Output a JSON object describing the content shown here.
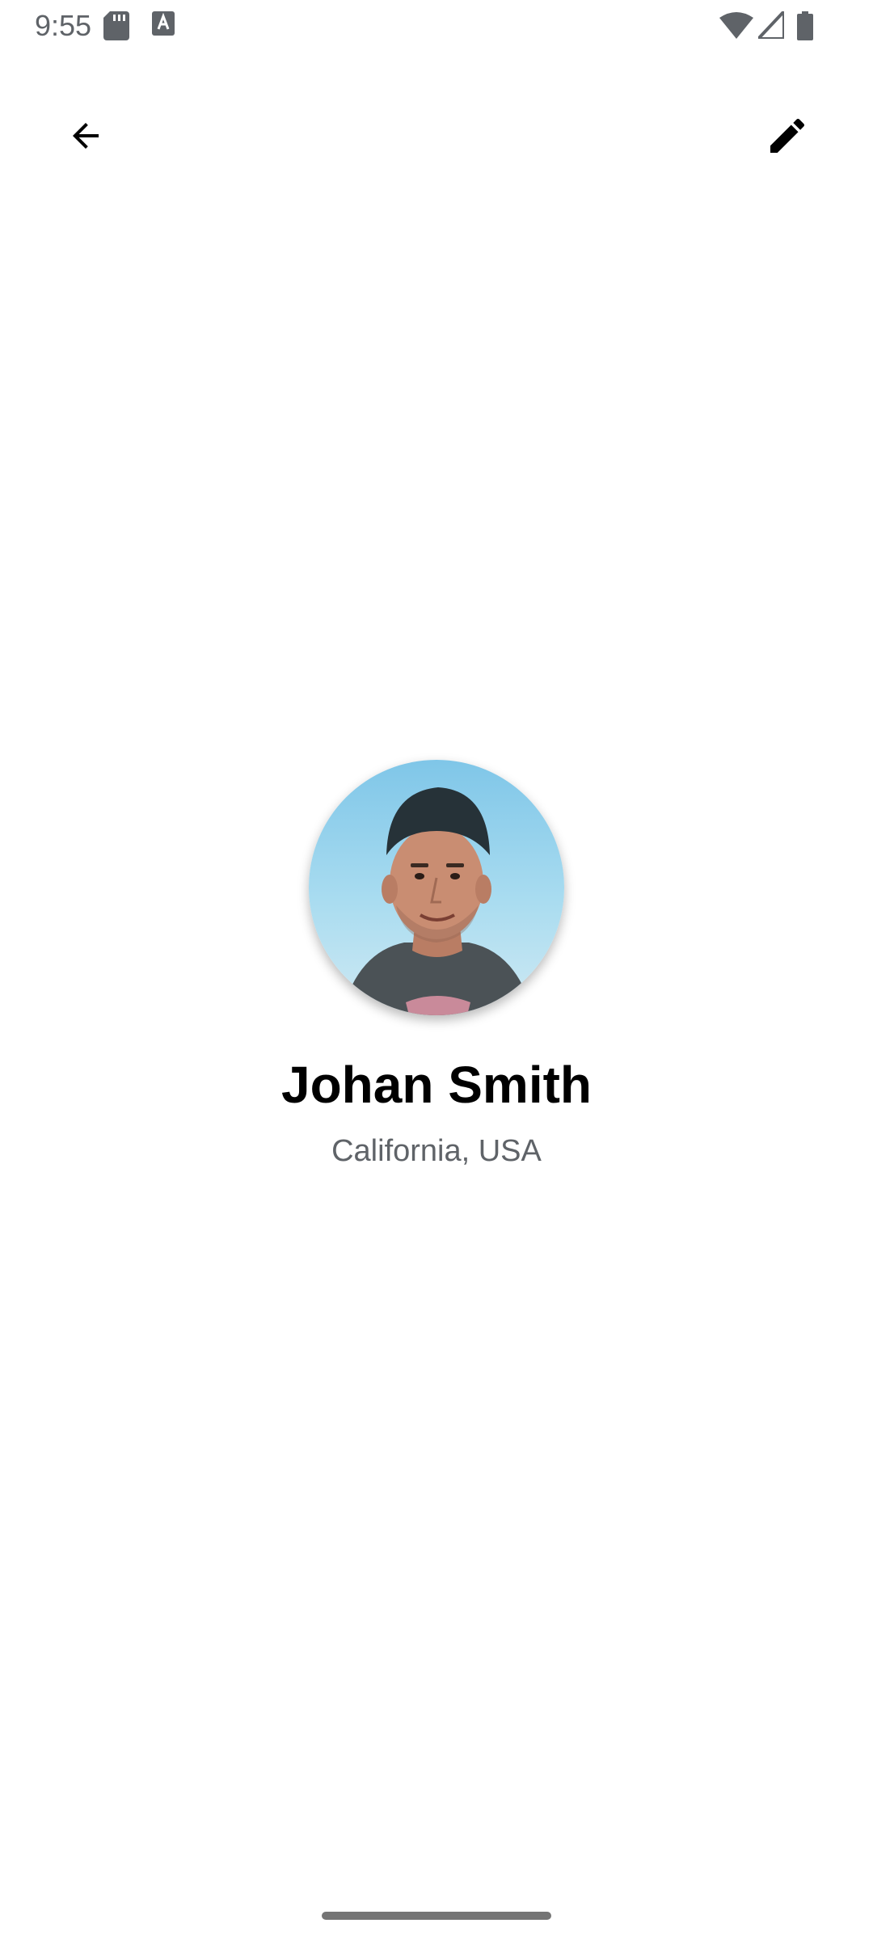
{
  "status_bar": {
    "time": "9:55",
    "icons": [
      "sd-card-icon",
      "a-notification-icon",
      "wifi-icon",
      "cell-signal-icon",
      "battery-icon"
    ]
  },
  "app_bar": {
    "back_icon": "arrow-back-icon",
    "edit_icon": "pencil-icon"
  },
  "profile": {
    "name": "Johan Smith",
    "location": "California, USA"
  },
  "colors": {
    "background": "#ffffff",
    "text_primary": "#000000",
    "text_secondary": "#5f6368"
  }
}
